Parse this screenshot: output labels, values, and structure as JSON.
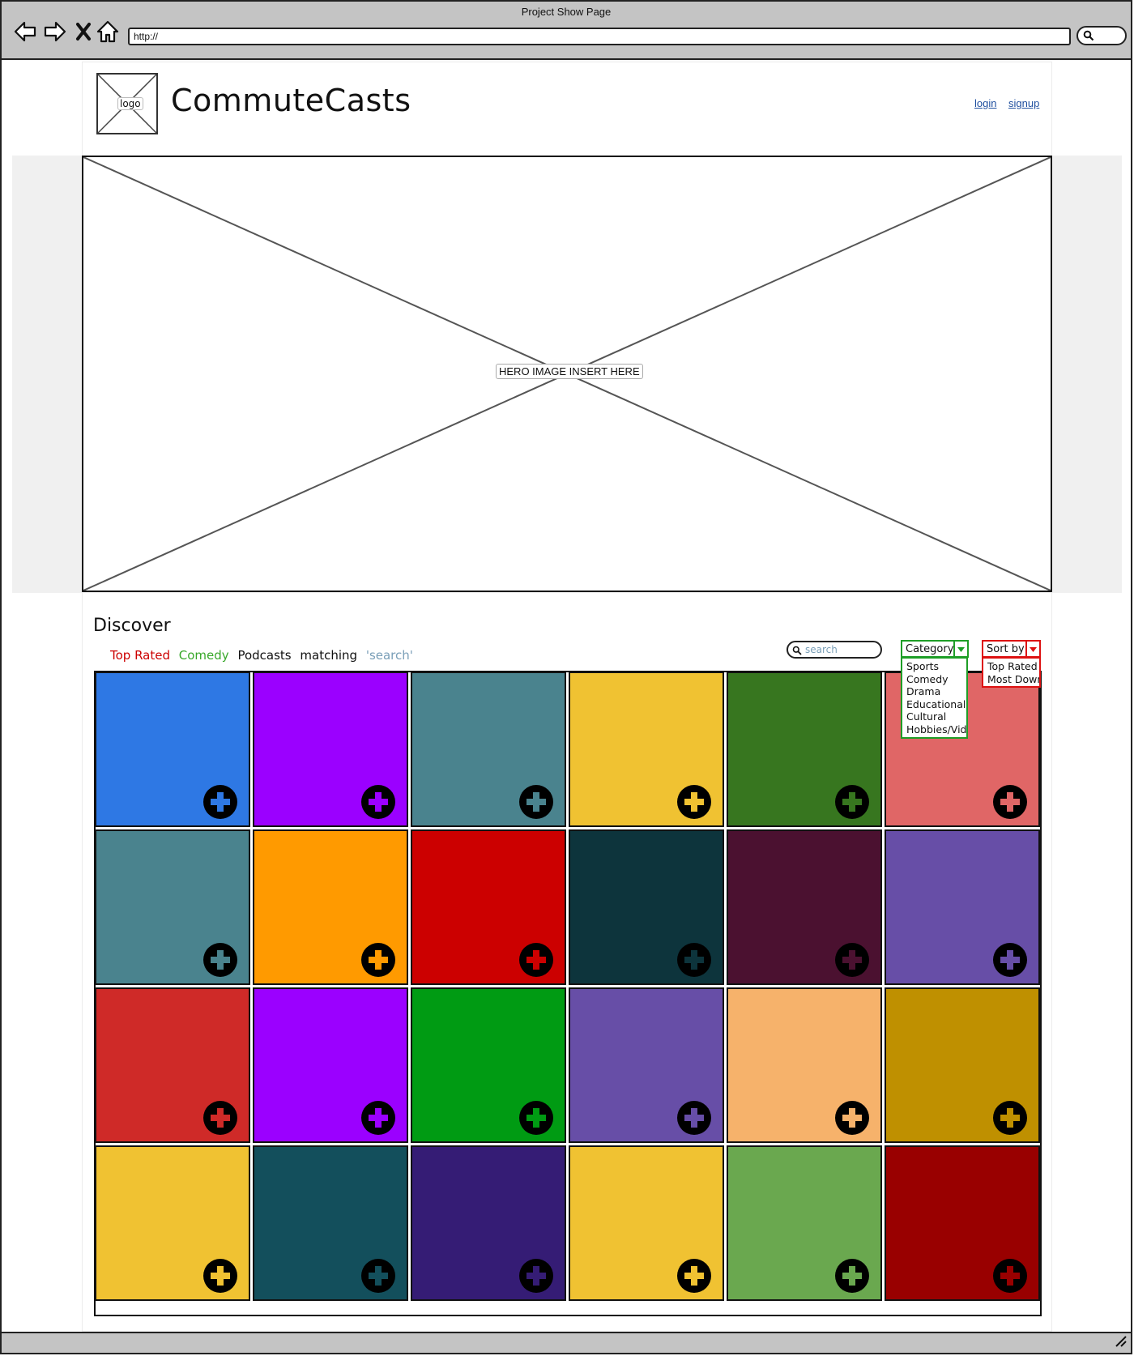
{
  "window": {
    "title": "Project Show Page",
    "url": "http://"
  },
  "header": {
    "brand": "CommuteCasts",
    "logo_label": "logo",
    "login": "login",
    "signup": "signup"
  },
  "hero": {
    "label": "HERO IMAGE INSERT HERE"
  },
  "discover": {
    "title": "Discover",
    "filter": {
      "sort_word": "Top Rated",
      "category_word": "Comedy",
      "noun": "Podcasts",
      "connector": "matching",
      "query": "'search'"
    },
    "search_placeholder": "search",
    "category": {
      "label": "Category",
      "options": [
        "Sports",
        "Comedy",
        "Drama",
        "Educational",
        "Cultural",
        "Hobbies/Video"
      ]
    },
    "sort": {
      "label": "Sort by",
      "options": [
        "Top Rated",
        "Most Downloaded"
      ]
    }
  },
  "colors": {
    "category_accent": "#1e9e27",
    "sort_accent": "#dd1111",
    "link": "#1f4f9f",
    "search_query": "#7a9fb8"
  },
  "tiles": [
    [
      "#2e78e4",
      "#9b00ff",
      "#4a838e",
      "#f0c232",
      "#37761f",
      "#e06666"
    ],
    [
      "#4a838e",
      "#ff9a00",
      "#cc0000",
      "#0d343c",
      "#4b1130",
      "#674ea7"
    ],
    [
      "#cf2a28",
      "#9b00ff",
      "#009b13",
      "#674ea7",
      "#f6b26b",
      "#bf9000"
    ],
    [
      "#f0c232",
      "#134f5c",
      "#351c75",
      "#f0c232",
      "#6aa84f",
      "#990000"
    ]
  ]
}
